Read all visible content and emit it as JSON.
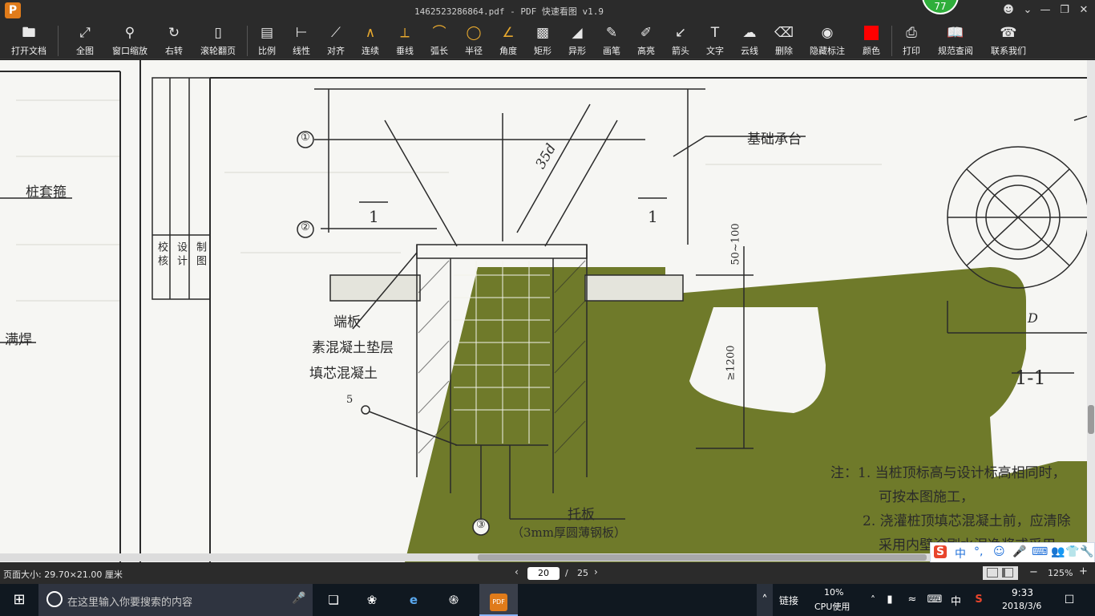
{
  "window": {
    "title": "1462523286864.pdf - PDF 快速看图 v1.9",
    "app_icon_letter": "P",
    "badge": "77"
  },
  "toolbar": [
    {
      "label": "打开文档",
      "icon": "folder-icon"
    },
    {
      "label": "全图",
      "icon": "fit-icon"
    },
    {
      "label": "窗口缩放",
      "icon": "zoom-icon"
    },
    {
      "label": "右转",
      "icon": "rotate-icon"
    },
    {
      "label": "滚轮翻页",
      "icon": "mouse-icon"
    },
    {
      "label": "比例",
      "icon": "scale-icon"
    },
    {
      "label": "线性",
      "icon": "linear-icon"
    },
    {
      "label": "对齐",
      "icon": "align-icon"
    },
    {
      "label": "连续",
      "icon": "continuous-icon"
    },
    {
      "label": "垂线",
      "icon": "perpendicular-icon"
    },
    {
      "label": "弧长",
      "icon": "arc-icon"
    },
    {
      "label": "半径",
      "icon": "radius-icon"
    },
    {
      "label": "角度",
      "icon": "angle-icon"
    },
    {
      "label": "矩形",
      "icon": "rect-icon"
    },
    {
      "label": "异形",
      "icon": "shape-icon"
    },
    {
      "label": "画笔",
      "icon": "pen-icon"
    },
    {
      "label": "高亮",
      "icon": "highlight-icon"
    },
    {
      "label": "箭头",
      "icon": "arrow-icon"
    },
    {
      "label": "文字",
      "icon": "text-icon"
    },
    {
      "label": "云线",
      "icon": "cloud-icon"
    },
    {
      "label": "删除",
      "icon": "eraser-icon"
    },
    {
      "label": "隐藏标注",
      "icon": "eye-icon"
    },
    {
      "label": "颜色",
      "icon": "color-icon"
    },
    {
      "label": "打印",
      "icon": "print-icon"
    },
    {
      "label": "规范查阅",
      "icon": "book-icon"
    },
    {
      "label": "联系我们",
      "icon": "contact-icon"
    }
  ],
  "colors": {
    "accent_orange": "#e07b1a",
    "measure_tool_yellow": "#e8a92e",
    "color_swatch_red": "#ff0000",
    "badge_green": "#2fae3b",
    "drawing_olive": "#6f7a2a"
  },
  "drawing": {
    "labels": {
      "pile_cage": "桩套箍",
      "full_weld": "满焊",
      "pile_cap": "基础承台",
      "end_plate": "端板",
      "plain_concrete": "素混凝土垫层",
      "core_concrete": "填芯混凝土",
      "tray_plate": "托板",
      "tray_plate_note": "（3mm厚圆薄钢板）",
      "dim_35d": "35d",
      "dim_50_100": "50~100",
      "dim_1200": "≥1200",
      "section_1_left": "1",
      "section_1_right": "1",
      "section_title": "1-1",
      "diameter": "D",
      "callout_1": "①",
      "callout_2": "②",
      "callout_3": "③",
      "callout_5": "5",
      "title_block_check": "校 核",
      "title_block_design": "设 计",
      "title_block_draw": "制 图"
    },
    "notes": {
      "prefix": "注：",
      "line1": "1. 当桩顶标高与设计标高相同时，",
      "line2": "可按本图施工，",
      "line3": "2. 浇灌桩顶填芯混凝土前，应清除",
      "line4": "采用内壁涂刷水泥净浆或采用"
    }
  },
  "ime": [
    "中",
    "°,",
    "☺",
    "🎤",
    "⌨",
    "👥",
    "👕",
    "🔧"
  ],
  "status": {
    "page_size": "页面大小: 29.70×21.00 厘米",
    "current_page": "20",
    "page_sep": "/",
    "total_pages": "25",
    "zoom": "125%",
    "minus": "−",
    "plus": "+"
  },
  "taskbar": {
    "search_placeholder": "在这里输入你要搜索的内容",
    "link_label": "链接",
    "cpu_percent": "10%",
    "cpu_label": "CPU使用",
    "ime_indicator": "中",
    "time": "9:33",
    "date": "2018/3/6"
  }
}
